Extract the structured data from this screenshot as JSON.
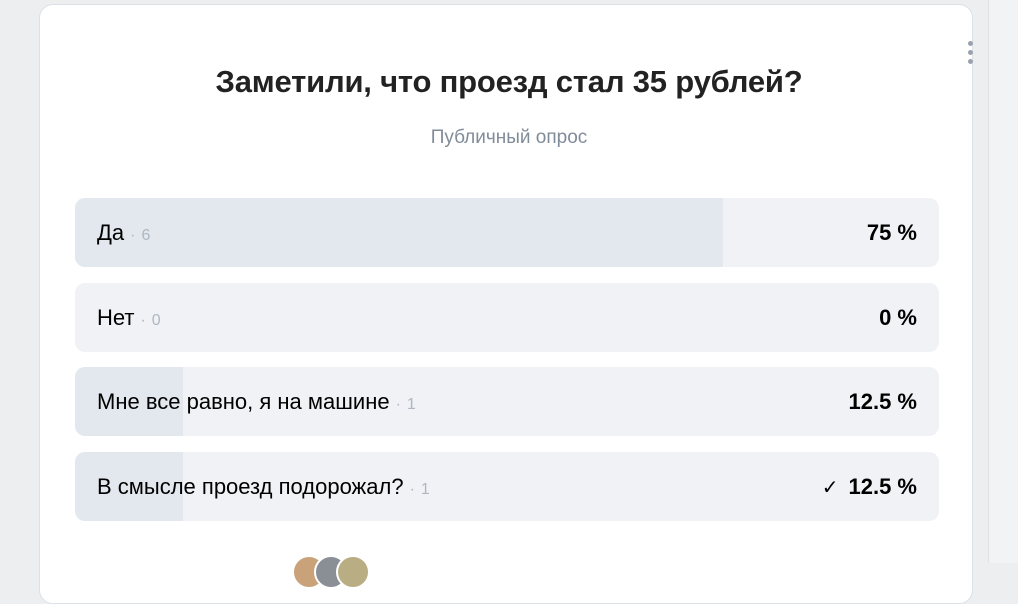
{
  "poll": {
    "title": "Заметили, что проезд стал 35 рублей?",
    "subtitle": "Публичный опрос",
    "separator": "·",
    "options": [
      {
        "label": "Да",
        "votes": "6",
        "percent": "75 %",
        "share": 0.75,
        "checkmark": ""
      },
      {
        "label": "Нет",
        "votes": "0",
        "percent": "0 %",
        "share": 0.0,
        "checkmark": ""
      },
      {
        "label": "Мне все равно, я на машине",
        "votes": "1",
        "percent": "12.5 %",
        "share": 0.125,
        "checkmark": ""
      },
      {
        "label": "В смысле проезд подорожал?",
        "votes": "1",
        "percent": "12.5 %",
        "share": 0.125,
        "checkmark": "✓"
      }
    ]
  },
  "colors": {
    "card_background": "#ffffff",
    "option_background": "#f0f2f5",
    "result_fill": "#e3e8ee",
    "muted_text": "#818c99"
  },
  "icons": {
    "menu": "more-vertical-icon",
    "selected": "check-icon"
  }
}
